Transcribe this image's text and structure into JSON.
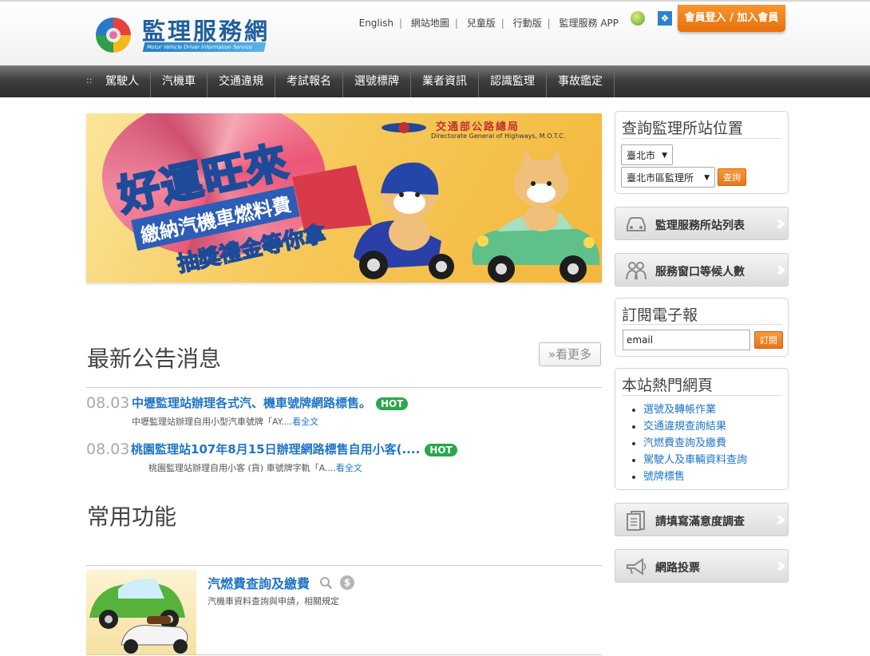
{
  "header": {
    "logo_title": "監理服務網",
    "logo_subtitle": "Motor Vehicle Driver Information Service",
    "links": [
      "English",
      "網站地圖",
      "兒童版",
      "行動版",
      "監理服務 APP"
    ],
    "login_button": "會員登入 / 加入會員"
  },
  "nav": {
    "items": [
      "駕駛人",
      "汽機車",
      "交通違規",
      "考試報名",
      "選號標牌",
      "業者資訊",
      "認識監理",
      "事故鑑定"
    ]
  },
  "banner": {
    "headline": "好運旺來",
    "line2": "繳納汽機車燃料費",
    "line3": "抽獎禮金等你拿",
    "org": "交通部公路總局",
    "org_en": "Directorate General of Highways, M.O.T.C."
  },
  "news": {
    "title": "最新公告消息",
    "more_label": "»看更多",
    "items": [
      {
        "date": "08.03",
        "title": "中壢監理站辦理各式汽、機車號牌網路標售。",
        "badge": "HOT",
        "desc": "中壢監理站辦理自用小型汽車號牌「AY....",
        "link": "看全文"
      },
      {
        "date": "08.03",
        "title": "桃園監理站107年8月15日辦理網路標售自用小客(....",
        "badge": "HOT",
        "desc": "桃園監理站辦理自用小客 (貨) 車號牌字軌「A....",
        "link": "看全文"
      }
    ]
  },
  "functions": {
    "title": "常用功能",
    "items": [
      {
        "title": "汽燃費查詢及繳費",
        "desc": "汽機車資料查詢與申請，相關規定"
      }
    ]
  },
  "sidebar": {
    "station_query": {
      "title": "查詢監理所站位置",
      "city_value": "臺北市",
      "office_value": "臺北市區監理所",
      "button": "查詢"
    },
    "buttons": {
      "station_list": "監理服務所站列表",
      "waiting_count": "服務窗口等候人數",
      "survey": "請填寫滿意度調查",
      "vote": "網路投票"
    },
    "newsletter": {
      "title": "訂閱電子報",
      "input_value": "email",
      "button": "訂閱"
    },
    "popular": {
      "title": "本站熱門網頁",
      "items": [
        "選號及轉帳作業",
        "交通違規查詢結果",
        "汽燃費查詢及繳費",
        "駕駛人及車輛資料查詢",
        "號牌標售"
      ]
    }
  }
}
